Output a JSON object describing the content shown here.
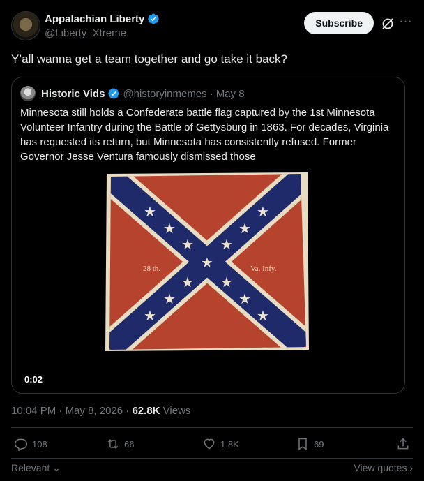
{
  "author": {
    "display_name": "Appalachian Liberty",
    "handle": "@Liberty_Xtreme"
  },
  "header": {
    "subscribe_label": "Subscribe"
  },
  "tweet": {
    "text": "Y’all wanna get a team together and go take it back?"
  },
  "quoted": {
    "display_name": "Historic Vids",
    "handle": "@historyinmemes",
    "separator": "·",
    "date": "May 8",
    "text": "Minnesota still holds a Confederate battle flag captured by the 1st Minnesota Volunteer Infantry during the Battle of Gettysburg in 1863. For decades, Virginia has requested its return, but Minnesota has consistently refused. Former Governor Jesse Ventura famously dismissed those",
    "media": {
      "video_time": "0:02",
      "flag_text_left": "28 th.",
      "flag_text_right": "Va. Infy."
    }
  },
  "meta": {
    "time": "10:04 PM",
    "sep1": "·",
    "date": "May 8, 2026",
    "sep2": "·",
    "views_count": "62.8K",
    "views_label": "Views"
  },
  "actions": {
    "replies": "108",
    "reposts": "66",
    "likes": "1.8K",
    "bookmarks": "69"
  },
  "footer": {
    "relevant_label": "Relevant",
    "view_quotes_label": "View quotes"
  },
  "colors": {
    "background": "#000000",
    "text": "#e7e9ea",
    "muted": "#71767b",
    "verified": "#1d9bf0",
    "border": "#2f3336"
  }
}
